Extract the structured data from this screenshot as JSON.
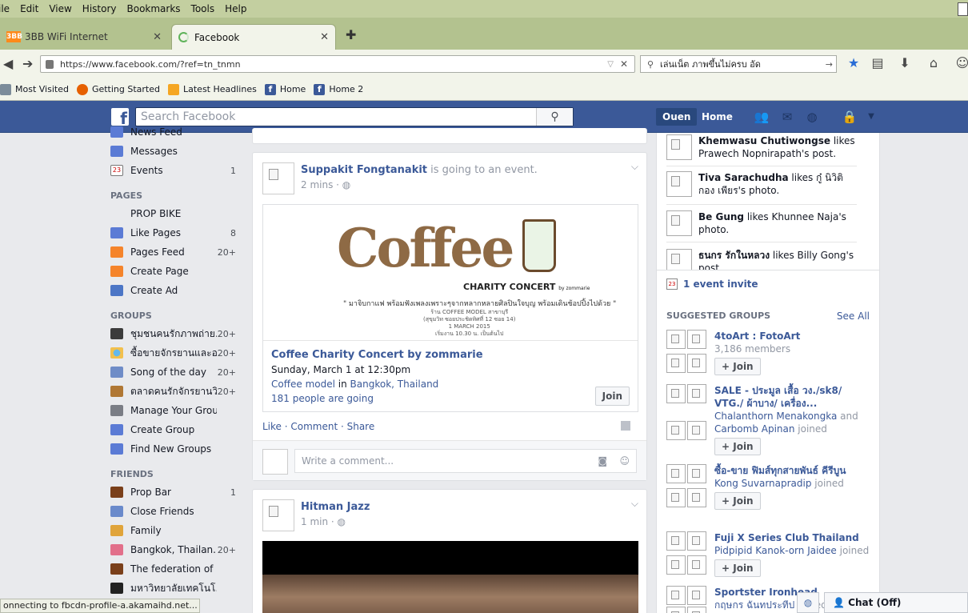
{
  "browser": {
    "menu": [
      "ile",
      "Edit",
      "View",
      "History",
      "Bookmarks",
      "Tools",
      "Help"
    ],
    "tabs": [
      {
        "label": "3BB WiFi Internet",
        "active": false
      },
      {
        "label": "Facebook",
        "active": true
      }
    ],
    "url": "https://www.facebook.com/?ref=tn_tnmn",
    "search_value": "เล่นเน็ต ภาพขึ้นไม่ครบ อัด",
    "bookmarks": [
      "Most Visited",
      "Getting Started",
      "Latest Headlines",
      "Home",
      "Home 2"
    ],
    "status": "onnecting to fbcdn-profile-a.akamaihd.net..."
  },
  "fb": {
    "search_placeholder": "Search Facebook",
    "profile_name": "Ouen",
    "home_label": "Home",
    "brand_color": "#3b5998"
  },
  "leftnav": {
    "top_items": [
      {
        "label": "News Feed",
        "count": "",
        "icon": "news-feed-icon"
      },
      {
        "label": "Messages",
        "count": "",
        "icon": "messages-icon"
      },
      {
        "label": "Events",
        "count": "1",
        "icon": "calendar-icon",
        "cal_day": "23"
      }
    ],
    "pages_header": "PAGES",
    "pages": [
      {
        "label": "PROP BIKE",
        "count": ""
      },
      {
        "label": "Like Pages",
        "count": "8"
      },
      {
        "label": "Pages Feed",
        "count": "20+"
      },
      {
        "label": "Create Page",
        "count": ""
      },
      {
        "label": "Create Ad",
        "count": ""
      }
    ],
    "groups_header": "GROUPS",
    "groups": [
      {
        "label": "ชุมชนคนรักภาพถ่าย...",
        "count": "20+"
      },
      {
        "label": "ซื้อขายจักรยานและอ...",
        "count": "20+"
      },
      {
        "label": "Song of the day",
        "count": "20+"
      },
      {
        "label": "ตลาดคนรักจักรยานวิ...",
        "count": "20+"
      },
      {
        "label": "Manage Your Groups",
        "count": ""
      },
      {
        "label": "Create Group",
        "count": ""
      },
      {
        "label": "Find New Groups",
        "count": ""
      }
    ],
    "friends_header": "FRIENDS",
    "friends": [
      {
        "label": "Prop Bar",
        "count": "1"
      },
      {
        "label": "Close Friends",
        "count": ""
      },
      {
        "label": "Family",
        "count": ""
      },
      {
        "label": "Bangkok, Thailan...",
        "count": "20+"
      },
      {
        "label": "The federation of I...",
        "count": ""
      },
      {
        "label": "มหาวิทยาลัยเทคโนโ...",
        "count": ""
      }
    ]
  },
  "feed": {
    "post1": {
      "author": "Suppakit Fongtanakit",
      "action": " is going to an event.",
      "time": "2 mins · ",
      "image_text": {
        "word": "Coffee",
        "subtitle": "CHARITY CONCERT",
        "by": "by zommarie",
        "thai_line": "\" มาจิบกาแฟ พร้อมฟังเพลงเพราะๆจากหลากหลายศิลปินใจบุญ พร้อมเดินช้อปปิ้งไปด้วย \"",
        "small_lines": [
          "ร้าน COFFEE MODEL สาขาบุรี",
          "(สุขุมวิท ซอยประชิดทิศที่ 12 ซอย 14)",
          "1 MARCH 2015",
          "เริ่มงาน 10.30 น. เป็นต้นไป"
        ]
      },
      "event_name": "Coffee Charity Concert by zommarie",
      "event_date": "Sunday, March 1 at 12:30pm",
      "event_venue": "Coffee model",
      "event_in": " in ",
      "event_city": "Bangkok, Thailand",
      "event_going": "181 people are going",
      "join_label": "Join",
      "actions": "Like · Comment · Share",
      "comment_placeholder": "Write a comment..."
    },
    "post2": {
      "author": "Hitman Jazz",
      "time": "1 min · "
    }
  },
  "right": {
    "ticker": [
      {
        "name": "Khemwasu Chutiwongse",
        "text": " likes Prawech Nopnirapath's post."
      },
      {
        "name": "Tiva Sarachudha",
        "text": " likes กู๋ นิวิติ กอง เพียร's photo."
      },
      {
        "name": "Be Gung",
        "text": " likes Khunnee Naja's photo."
      },
      {
        "name": "ธนกร รักในหลวง",
        "text": " likes Billy Gong's post."
      }
    ],
    "event_invite": "1 event invite",
    "event_invite_day": "23",
    "suggested_header": "SUGGESTED GROUPS",
    "see_all": "See All",
    "groups": [
      {
        "name": "4toArt : FotoArt",
        "sub_plain": "3,186 members",
        "sub_link": "",
        "sub_link2": "",
        "join": "+ Join"
      },
      {
        "name": "SALE - ประมูล เสื้อ วง./sk8/ VTG./ ผ้าบาง/ เครื่อง...",
        "sub_link": "Chalanthorn Menakongka",
        "sub_mid": " and ",
        "sub_link2": "Carbomb Apinan",
        "sub_plain": " joined",
        "join": "+ Join"
      },
      {
        "name": "ซื้อ-ขาย ฟิมส์ทุกสายพันธ์ คีรีบูน",
        "sub_link": "Kong Suvarnapradip",
        "sub_mid": "",
        "sub_link2": "",
        "sub_plain": " joined",
        "join": "+ Join"
      },
      {
        "name": "Fuji X Series Club Thailand",
        "sub_link": "Pidpipid Kanok-orn Jaidee",
        "sub_mid": "",
        "sub_link2": "",
        "sub_plain": " joined",
        "join": "+ Join"
      },
      {
        "name": "Sportster Ironhead",
        "sub_link": "กฤษกร ฉันทประทีป",
        "sub_mid": "",
        "sub_link2": "",
        "sub_plain": " joined",
        "join": ""
      }
    ],
    "chat_label": "Chat (Off)"
  }
}
